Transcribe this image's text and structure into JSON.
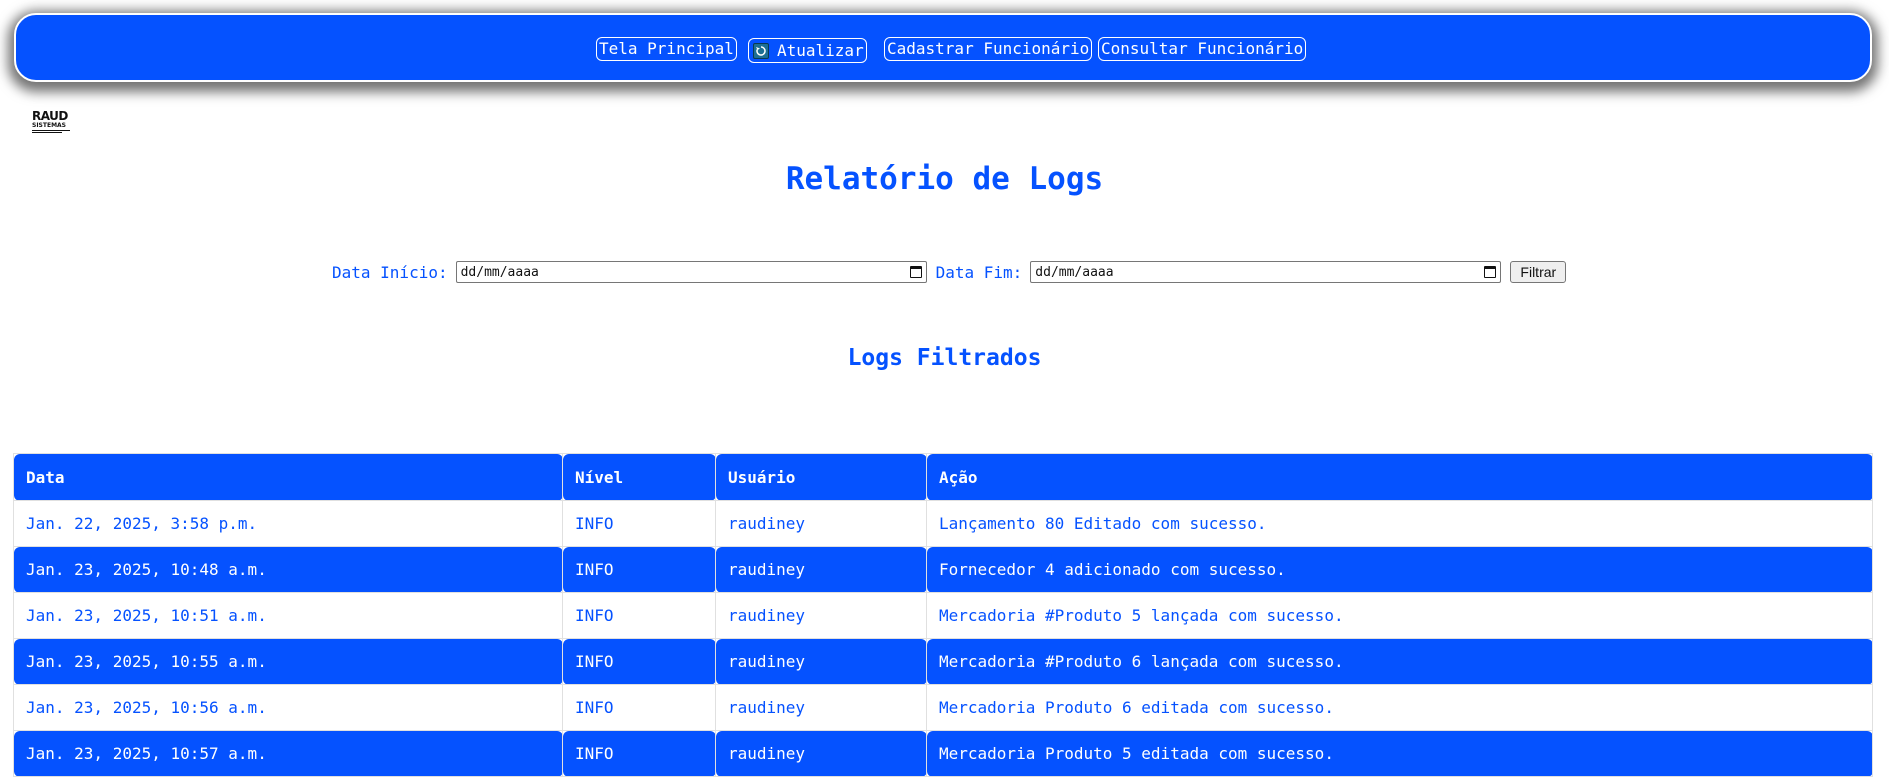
{
  "nav": {
    "home_label": "Tela Principal",
    "refresh_label": "Atualizar",
    "register_label": "Cadastrar Funcionário",
    "query_label": "Consultar Funcionário"
  },
  "logo": {
    "line1": "RAUD",
    "line2": "SISTEMAS"
  },
  "page": {
    "title": "Relatório de Logs",
    "subtitle": "Logs Filtrados"
  },
  "filter": {
    "start_label": "Data Início:",
    "start_value": "dd/mm/aaaa",
    "end_label": "Data Fim:",
    "end_value": "dd/mm/aaaa",
    "button_label": "Filtrar"
  },
  "table": {
    "headers": [
      "Data",
      "Nível",
      "Usuário",
      "Ação"
    ],
    "rows": [
      [
        "Jan. 22, 2025, 3:58 p.m.",
        "INFO",
        "raudiney",
        "Lançamento 80 Editado com sucesso."
      ],
      [
        "Jan. 23, 2025, 10:48 a.m.",
        "INFO",
        "raudiney",
        "Fornecedor 4 adicionado com sucesso."
      ],
      [
        "Jan. 23, 2025, 10:51 a.m.",
        "INFO",
        "raudiney",
        "Mercadoria #Produto 5 lançada com sucesso."
      ],
      [
        "Jan. 23, 2025, 10:55 a.m.",
        "INFO",
        "raudiney",
        "Mercadoria #Produto 6 lançada com sucesso."
      ],
      [
        "Jan. 23, 2025, 10:56 a.m.",
        "INFO",
        "raudiney",
        "Mercadoria Produto 6 editada com sucesso."
      ],
      [
        "Jan. 23, 2025, 10:57 a.m.",
        "INFO",
        "raudiney",
        "Mercadoria Produto 5 editada com sucesso."
      ]
    ]
  },
  "colors": {
    "primary": "#0552ff",
    "text_on_primary": "#ffffff"
  }
}
